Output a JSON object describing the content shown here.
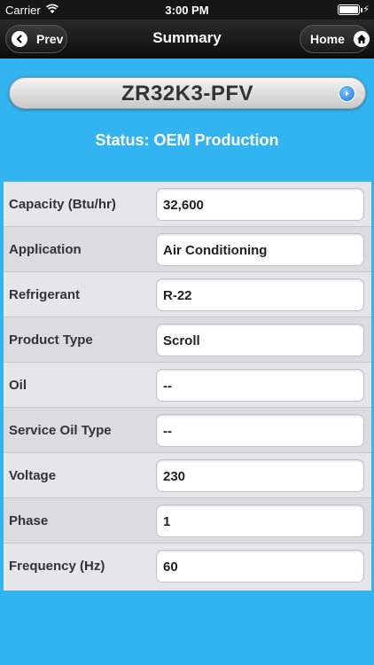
{
  "status_bar": {
    "carrier": "Carrier",
    "time": "3:00 PM",
    "battery_level": 1.0
  },
  "nav": {
    "title": "Summary",
    "prev_label": "Prev",
    "home_label": "Home"
  },
  "model": {
    "name": "ZR32K3-PFV"
  },
  "status": "Status: OEM Production",
  "rows": [
    {
      "label": "Capacity (Btu/hr)",
      "value": "32,600"
    },
    {
      "label": "Application",
      "value": "Air Conditioning"
    },
    {
      "label": "Refrigerant",
      "value": "R-22"
    },
    {
      "label": "Product Type",
      "value": "Scroll"
    },
    {
      "label": "Oil",
      "value": "--"
    },
    {
      "label": "Service Oil Type",
      "value": "--"
    },
    {
      "label": "Voltage",
      "value": "230"
    },
    {
      "label": "Phase",
      "value": "1"
    },
    {
      "label": "Frequency (Hz)",
      "value": "60"
    }
  ],
  "colors": {
    "background": "#32b4f0",
    "nav_bar": "#161616",
    "info_button": "#1a73d8"
  },
  "icons": {
    "prev": "chevron-left-icon",
    "home": "home-icon",
    "info": "info-arrow-icon",
    "wifi": "wifi-icon",
    "battery": "battery-icon"
  }
}
